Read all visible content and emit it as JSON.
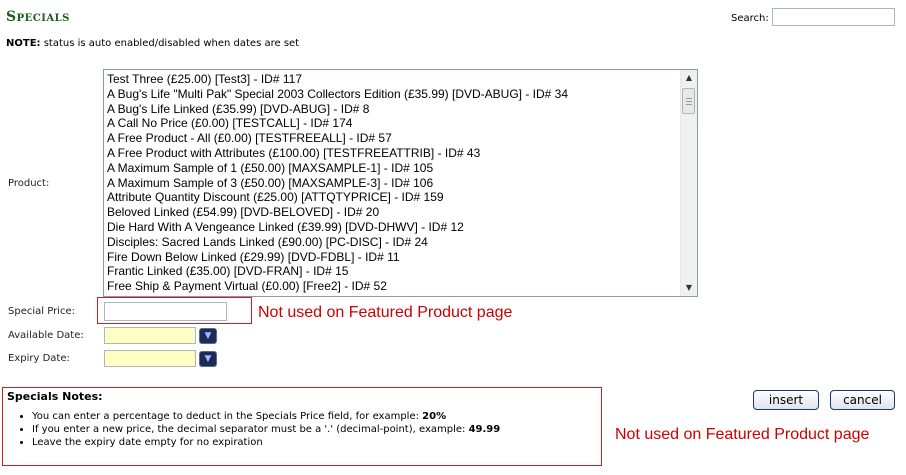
{
  "header": {
    "title": "Specials",
    "search_label": "Search:",
    "search_value": ""
  },
  "note": {
    "bold": "NOTE:",
    "text": " status is auto enabled/disabled when dates are set"
  },
  "form": {
    "product_label": "Product:",
    "products": [
      "Test Three (£25.00) [Test3] - ID# 117",
      "A Bug's Life \"Multi Pak\" Special 2003 Collectors Edition (£35.99) [DVD-ABUG] - ID# 34",
      "A Bug's Life Linked (£35.99) [DVD-ABUG] - ID# 8",
      "A Call No Price (£0.00) [TESTCALL] - ID# 174",
      "A Free Product - All (£0.00) [TESTFREEALL] - ID# 57",
      "A Free Product with Attributes (£100.00) [TESTFREEATTRIB] - ID# 43",
      "A Maximum Sample of 1 (£50.00) [MAXSAMPLE-1] - ID# 105",
      "A Maximum Sample of 3 (£50.00) [MAXSAMPLE-3] - ID# 106",
      "Attribute Quantity Discount (£25.00) [ATTQTYPRICE] - ID# 159",
      "Beloved Linked (£54.99) [DVD-BELOVED] - ID# 20",
      "Die Hard With A Vengeance Linked (£39.99) [DVD-DHWV] - ID# 12",
      "Disciples: Sacred Lands Linked (£90.00) [PC-DISC] - ID# 24",
      "Fire Down Below Linked (£29.99) [DVD-FDBL] - ID# 11",
      "Frantic Linked (£35.00) [DVD-FRAN] - ID# 15",
      "Free Ship & Payment Virtual (£0.00) [Free2] - ID# 52"
    ],
    "special_price_label": "Special Price:",
    "special_price_value": "",
    "available_date_label": "Available Date:",
    "available_date_value": "",
    "expiry_date_label": "Expiry Date:",
    "expiry_date_value": "",
    "calendar_glyph": "▼"
  },
  "annotations": {
    "price_note": "Not used on Featured Product page",
    "notes_note": "Not used on Featured Product page"
  },
  "notes": {
    "title": "Specials Notes:",
    "items": [
      {
        "text": "You can enter a percentage to deduct in the Specials Price field, for example: ",
        "bold": "20%"
      },
      {
        "text": "If you enter a new price, the decimal separator must be a '.' (decimal-point), example: ",
        "bold": "49.99"
      },
      {
        "text": "Leave the expiry date empty for no expiration",
        "bold": ""
      }
    ]
  },
  "buttons": {
    "insert": "insert",
    "cancel": "cancel"
  },
  "colors": {
    "title_green": "#1d5c1d",
    "annotation_red": "#cc0000",
    "date_field_yellow": "#ffffc4"
  }
}
